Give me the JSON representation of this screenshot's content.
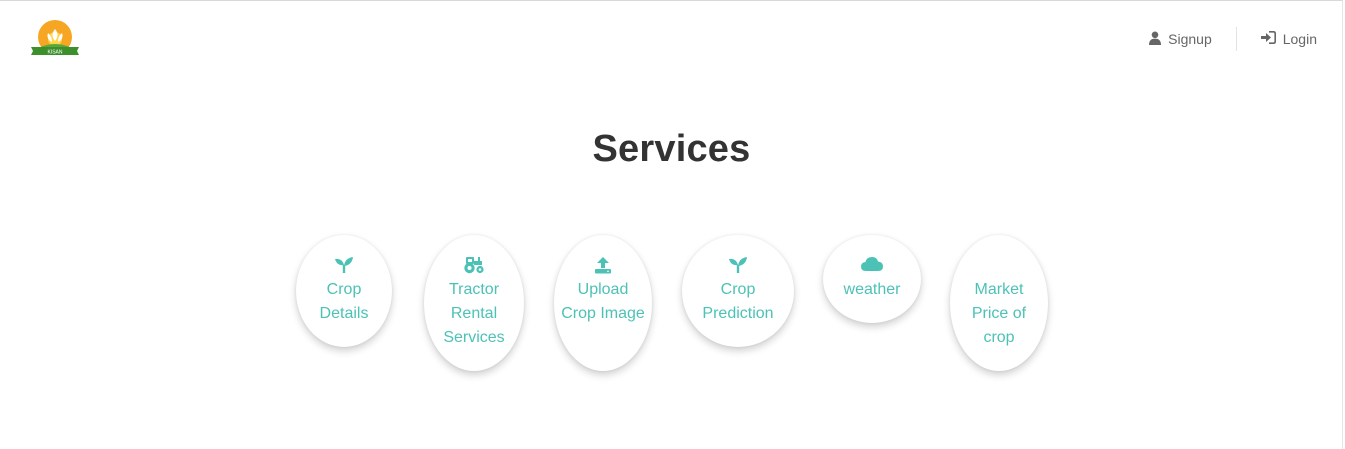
{
  "header": {
    "logo_text": "KISAN",
    "nav": {
      "signup_label": "Signup",
      "login_label": "Login"
    }
  },
  "main": {
    "title": "Services",
    "services": [
      {
        "label": "Crop Details",
        "icon": "sprout-icon"
      },
      {
        "label": "Tractor Rental Services",
        "icon": "tractor-icon"
      },
      {
        "label": "Upload Crop Image",
        "icon": "upload-icon"
      },
      {
        "label": "Crop Prediction",
        "icon": "sprout-icon"
      },
      {
        "label": "weather",
        "icon": "cloud-icon"
      },
      {
        "label": "Market Price of crop",
        "icon": ""
      }
    ]
  },
  "colors": {
    "accent": "#4cc2b6",
    "title": "#333333",
    "nav_text": "#666666"
  }
}
